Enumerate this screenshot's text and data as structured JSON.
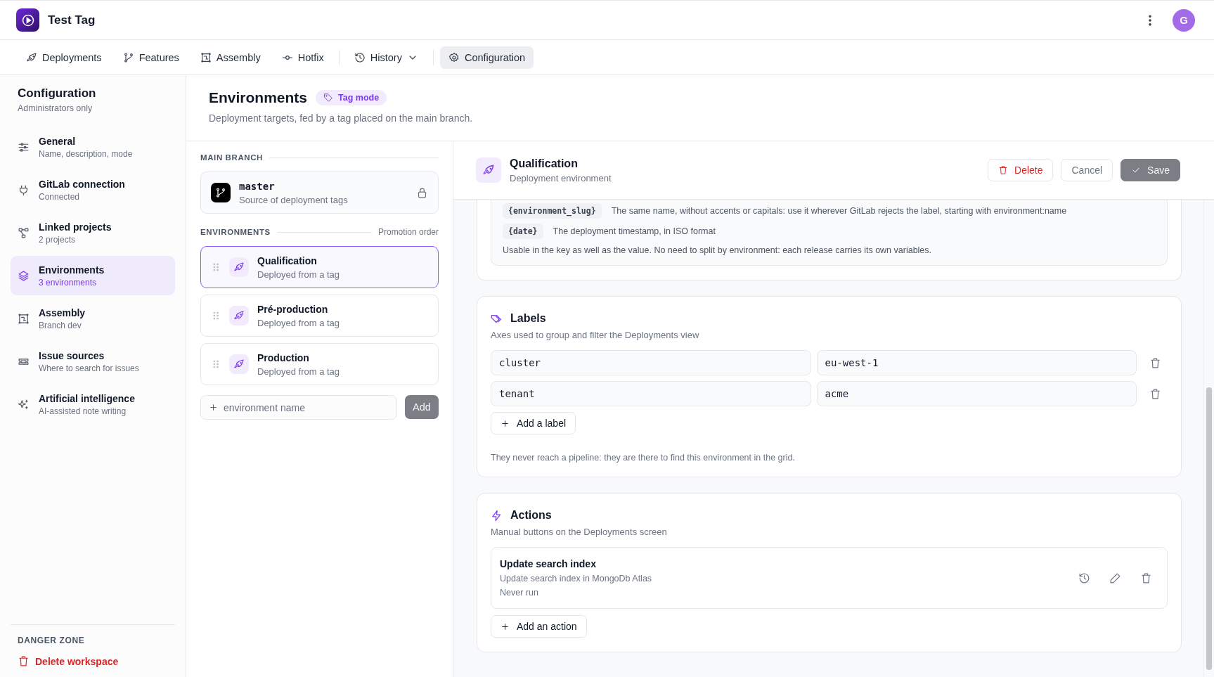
{
  "app": {
    "title": "Test Tag",
    "avatar": "G"
  },
  "nav": [
    [
      {
        "label": "Deployments",
        "selected": false,
        "dropdown": false
      },
      {
        "label": "Features",
        "selected": false,
        "dropdown": false
      },
      {
        "label": "Assembly",
        "selected": false,
        "dropdown": false
      },
      {
        "label": "Hotfix",
        "selected": false,
        "dropdown": false
      }
    ],
    [
      {
        "label": "History",
        "selected": false,
        "dropdown": true
      }
    ],
    [
      {
        "label": "Configuration",
        "selected": true,
        "dropdown": false
      }
    ]
  ],
  "sidebar": {
    "title": "Configuration",
    "subtitle": "Administrators only",
    "items": [
      {
        "label": "General",
        "detail": "Name, description, mode",
        "selected": false
      },
      {
        "label": "GitLab connection",
        "detail": "Connected",
        "selected": false
      },
      {
        "label": "Linked projects",
        "detail": "2 projects",
        "selected": false
      },
      {
        "label": "Environments",
        "detail": "3 environments",
        "selected": true
      },
      {
        "label": "Assembly",
        "detail": "Branch dev",
        "selected": false
      },
      {
        "label": "Issue sources",
        "detail": "Where to search for issues",
        "selected": false
      },
      {
        "label": "Artificial intelligence",
        "detail": "AI-assisted note writing",
        "selected": false
      }
    ],
    "danger_zone": {
      "heading": "DANGER ZONE",
      "action": "Delete workspace"
    }
  },
  "page": {
    "title": "Environments",
    "badge": "Tag mode",
    "description": "Deployment targets, fed by a tag placed on the main branch."
  },
  "environments_panel": {
    "main_branch": {
      "heading": "MAIN BRANCH",
      "name": "master",
      "detail": "Source of deployment tags",
      "locked": true
    },
    "environments": {
      "heading": "ENVIRONMENTS",
      "note": "Promotion order",
      "items": [
        {
          "name": "Qualification",
          "detail": "Deployed from a tag",
          "selected": true
        },
        {
          "name": "Pré-production",
          "detail": "Deployed from a tag",
          "selected": false
        },
        {
          "name": "Production",
          "detail": "Deployed from a tag",
          "selected": false
        }
      ]
    },
    "new_environment": {
      "placeholder": "environment name",
      "button": "Add",
      "disabled": true
    }
  },
  "detail": {
    "title": "Qualification",
    "subtitle": "Deployment environment",
    "buttons": [
      {
        "label": "Delete",
        "kind": "danger",
        "disabled": false
      },
      {
        "label": "Cancel",
        "kind": "plain",
        "disabled": false
      },
      {
        "label": "Save",
        "kind": "primary",
        "disabled": true
      }
    ],
    "variables": {
      "placeholders": [
        {
          "token": "{environment_slug}",
          "description": "The same name, without accents or capitals: use it wherever GitLab rejects the label, starting with environment:name"
        },
        {
          "token": "{date}",
          "description": "The deployment timestamp, in ISO format"
        }
      ],
      "note": "Usable in the key as well as the value. No need to split by environment: each release carries its own variables."
    },
    "labels": {
      "title": "Labels",
      "description": "Axes used to group and filter the Deployments view",
      "rows": [
        {
          "key": "cluster",
          "value": "eu-west-1"
        },
        {
          "key": "tenant",
          "value": "acme"
        }
      ],
      "add_button": "Add a label",
      "note": "They never reach a pipeline: they are there to find this environment in the grid."
    },
    "actions": {
      "title": "Actions",
      "description": "Manual buttons on the Deployments screen",
      "items": [
        {
          "name": "Update search index",
          "description": "Update search index in MongoDb Atlas",
          "last_run": "Never run"
        }
      ],
      "add_button": "Add an action"
    }
  }
}
